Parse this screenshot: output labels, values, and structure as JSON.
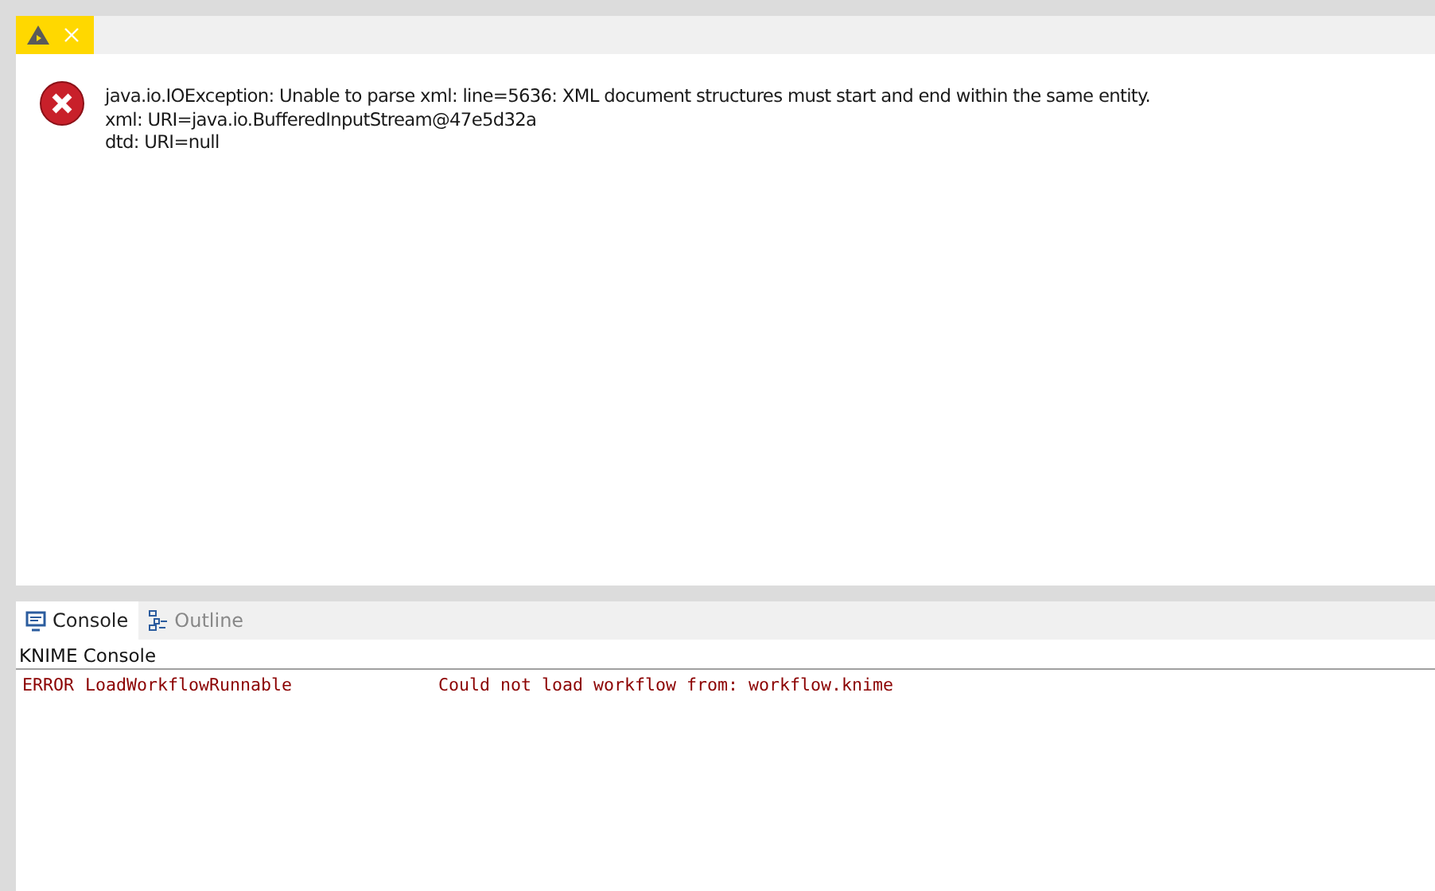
{
  "editor_tab": {
    "selected": true
  },
  "error": {
    "lines": [
      "java.io.IOException: Unable to parse xml: line=5636: XML document structures must start and end within the same entity.",
      "xml: URI=java.io.BufferedInputStream@47e5d32a",
      "dtd: URI=null"
    ]
  },
  "bottom_tabs": [
    {
      "label": "Console",
      "kind": "console",
      "selected": true
    },
    {
      "label": "Outline",
      "kind": "outline",
      "selected": false
    }
  ],
  "console": {
    "title": "KNIME Console",
    "lines": [
      {
        "level": "ERROR",
        "source": "LoadWorkflowRunnable",
        "message": "Could not load workflow from: workflow.knime"
      }
    ]
  }
}
